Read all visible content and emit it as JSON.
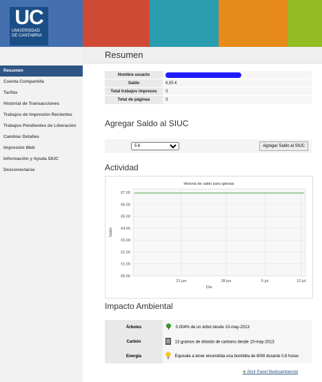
{
  "header": {
    "logo_text": "UC",
    "logo_line1": "UNIVERSIDAD",
    "logo_line2": "DE CANTABRIA",
    "colors": [
      "#4470b0",
      "#cf4a35",
      "#2a9cb0",
      "#e68a1a",
      "#93bb24"
    ]
  },
  "sidebar": {
    "items": [
      {
        "label": "Resumen",
        "active": true
      },
      {
        "label": "Cuenta Compartida"
      },
      {
        "label": "Tarifas"
      },
      {
        "label": "Historial de Transacciones"
      },
      {
        "label": "Trabajos de Impresión Recientes"
      },
      {
        "label": "Trabajos Pendientes de Liberación"
      },
      {
        "label": "Cambiar Detalles"
      },
      {
        "label": "Impresión Web"
      },
      {
        "label": "Información y Ayuda SIUC"
      },
      {
        "label": "Desconectarse"
      }
    ]
  },
  "summary": {
    "title": "Resumen",
    "rows": [
      {
        "label": "Nombre usuario",
        "value": ""
      },
      {
        "label": "Saldo",
        "value": "6,95 €"
      },
      {
        "label": "Total trabajos impresos",
        "value": "3"
      },
      {
        "label": "Total de páginas",
        "value": "3"
      }
    ]
  },
  "add_balance": {
    "title": "Agregar Saldo al SIUC",
    "selected_amount": "5 €",
    "button_label": "Agregar Saldo al SIUC"
  },
  "activity": {
    "title": "Actividad"
  },
  "chart_data": {
    "type": "line",
    "title": "Historia de saldo para iglesias",
    "xlabel": "Día",
    "ylabel": "Saldo",
    "y_ticks": [
      "€0.00",
      "€1.00",
      "€2.00",
      "€3.00",
      "€4.00",
      "€5.00",
      "€6.00",
      "€7.00"
    ],
    "x_ticks": [
      "21 jun",
      "28 jun",
      "5 jul",
      "12 jul"
    ],
    "ylim": [
      0,
      7.3
    ],
    "series": [
      {
        "values": [
          6.95,
          6.95
        ]
      }
    ],
    "x": [
      "start",
      "end"
    ],
    "line_color": "#4caf50",
    "grid": true
  },
  "environment": {
    "title": "Impacto Ambiental",
    "rows": [
      {
        "label": "Árboles",
        "value": "0.004% de un árbol desde 10-may-2013",
        "icon": "tree-icon"
      },
      {
        "label": "Carbón",
        "value": "13 gramos de dióxido de carbono desde 10-may-2013",
        "icon": "bin-icon"
      },
      {
        "label": "Energía",
        "value": "Equivale a tener encendida una bombilla de 60W durante 0,8 horas",
        "icon": "bulb-icon"
      }
    ],
    "panel_link": "Abrir Panel Medioambiental"
  }
}
